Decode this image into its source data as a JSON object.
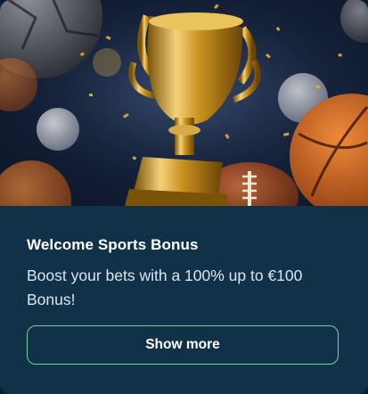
{
  "promo": {
    "title": "Welcome Sports Bonus",
    "description": "Boost your bets with a 100% up to €100 Bonus!",
    "cta_label": "Show more"
  },
  "colors": {
    "panel_background": "#113148",
    "title_text": "#ffffff",
    "body_text": "#d9e6ee",
    "button_border": "#6fd39a"
  }
}
